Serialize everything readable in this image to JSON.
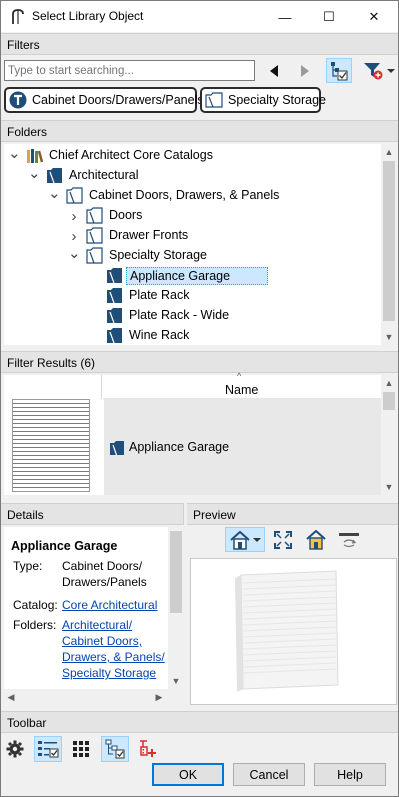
{
  "window": {
    "title": "Select Library Object",
    "minimize_glyph": "—",
    "maximize_glyph": "☐",
    "close_glyph": "✕"
  },
  "filters": {
    "header": "Filters",
    "search_placeholder": "Type to start searching...",
    "chips": [
      {
        "label": "Cabinet Doors/Drawers/Panels",
        "icon": "catalog-circle-icon"
      },
      {
        "label": "Specialty Storage",
        "icon": "folder-icon"
      }
    ]
  },
  "folders": {
    "header": "Folders",
    "items": [
      {
        "label": "Chief Architect Core Catalogs",
        "expander": "expanded",
        "icon": "library-books-icon"
      },
      {
        "label": "Architectural",
        "expander": "expanded",
        "icon": "dark-folder-icon"
      },
      {
        "label": "Cabinet Doors, Drawers, & Panels",
        "expander": "expanded",
        "icon": "folder-icon"
      },
      {
        "label": "Doors",
        "expander": "collapsed",
        "icon": "folder-icon"
      },
      {
        "label": "Drawer Fronts",
        "expander": "collapsed",
        "icon": "folder-icon"
      },
      {
        "label": "Specialty Storage",
        "expander": "expanded",
        "icon": "folder-icon"
      },
      {
        "label": "Appliance Garage",
        "expander": "none",
        "icon": "dark-folder-icon",
        "selected": true
      },
      {
        "label": "Plate Rack",
        "expander": "none",
        "icon": "dark-folder-icon"
      },
      {
        "label": "Plate Rack - Wide",
        "expander": "none",
        "icon": "dark-folder-icon"
      },
      {
        "label": "Wine Rack",
        "expander": "none",
        "icon": "dark-folder-icon"
      }
    ]
  },
  "filter_results": {
    "header": "Filter Results (6)",
    "column_name": "Name",
    "sort_glyph": "^",
    "rows": [
      {
        "name": "Appliance Garage"
      }
    ]
  },
  "details": {
    "header": "Details",
    "object_name": "Appliance Garage",
    "type_label": "Type:",
    "type_line1": "Cabinet Doors/",
    "type_line2": "Drawers/Panels",
    "catalog_label": "Catalog:",
    "catalog_value": "Core Architectural",
    "folders_label": "Folders:",
    "folders_line1": "Architectural/",
    "folders_line2": "Cabinet Doors,",
    "folders_line3": "Drawers, & Panels/",
    "folders_line4": "Specialty Storage"
  },
  "preview": {
    "header": "Preview"
  },
  "toolbar": {
    "header": "Toolbar"
  },
  "buttons": {
    "ok": "OK",
    "cancel": "Cancel",
    "help": "Help"
  },
  "colors": {
    "selection_bg": "#cce8ff",
    "selection_border": "#26a0da",
    "link": "#0645ad",
    "icon_blue": "#1f4e79",
    "default_button_border": "#0078d7"
  }
}
